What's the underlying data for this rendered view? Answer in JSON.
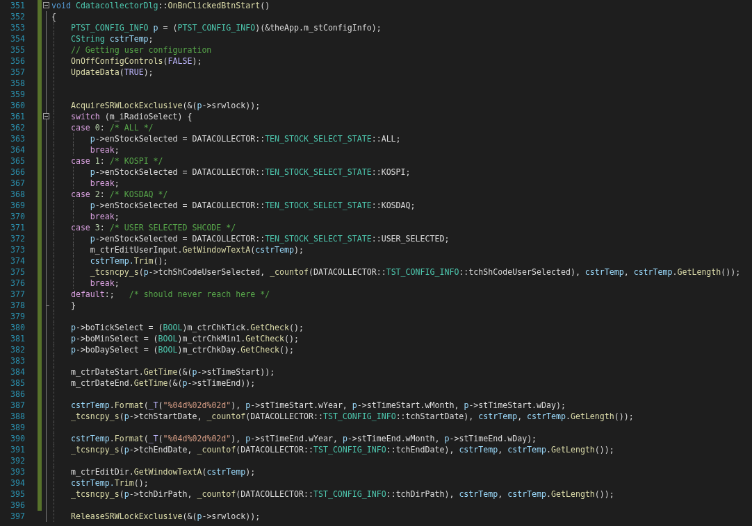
{
  "editor": {
    "lines": [
      {
        "n": "351",
        "collapsible": true,
        "block_end": false,
        "tokens": [
          {
            "text": "void",
            "kind": "keyword"
          },
          {
            "text": " CdatacollectorDlg",
            "kind": "type"
          },
          {
            "text": "::",
            "kind": "plain"
          },
          {
            "text": "OnBnClickedBtnStart",
            "kind": "function"
          },
          {
            "text": "()",
            "kind": "plain"
          }
        ]
      },
      {
        "n": "352",
        "collapsible": false,
        "block_end": false,
        "tokens": [
          {
            "text": "{",
            "kind": "plain"
          }
        ]
      },
      {
        "n": "353",
        "collapsible": false,
        "block_end": false,
        "tokens": [
          {
            "text": "    PTST_CONFIG_INFO",
            "kind": "type"
          },
          {
            "text": " p",
            "kind": "variable"
          },
          {
            "text": " = (",
            "kind": "plain"
          },
          {
            "text": "PTST_CONFIG_INFO",
            "kind": "type"
          },
          {
            "text": ")(&theApp.m_stConfigInfo);",
            "kind": "plain"
          }
        ]
      },
      {
        "n": "354",
        "collapsible": false,
        "block_end": false,
        "tokens": [
          {
            "text": "    CString",
            "kind": "type"
          },
          {
            "text": " cstrTemp",
            "kind": "variable"
          },
          {
            "text": ";",
            "kind": "plain"
          }
        ]
      },
      {
        "n": "355",
        "collapsible": false,
        "block_end": false,
        "tokens": [
          {
            "text": "    // Getting user configuration",
            "kind": "comment"
          }
        ]
      },
      {
        "n": "356",
        "collapsible": false,
        "block_end": false,
        "tokens": [
          {
            "text": "    OnOffConfigControls",
            "kind": "function"
          },
          {
            "text": "(",
            "kind": "plain"
          },
          {
            "text": "FALSE",
            "kind": "macro"
          },
          {
            "text": ");",
            "kind": "plain"
          }
        ]
      },
      {
        "n": "357",
        "collapsible": false,
        "block_end": false,
        "tokens": [
          {
            "text": "    UpdateData",
            "kind": "function"
          },
          {
            "text": "(",
            "kind": "plain"
          },
          {
            "text": "TRUE",
            "kind": "macro"
          },
          {
            "text": ");",
            "kind": "plain"
          }
        ]
      },
      {
        "n": "358",
        "collapsible": false,
        "block_end": false
      },
      {
        "n": "359",
        "collapsible": false,
        "block_end": false
      },
      {
        "n": "360",
        "collapsible": false,
        "block_end": false,
        "tokens": [
          {
            "text": "    AcquireSRWLockExclusive",
            "kind": "function"
          },
          {
            "text": "(&(",
            "kind": "plain"
          },
          {
            "text": "p",
            "kind": "variable"
          },
          {
            "text": "->srwlock));",
            "kind": "plain"
          }
        ]
      },
      {
        "n": "361",
        "collapsible": true,
        "block_end": false,
        "tokens": [
          {
            "text": "    switch",
            "kind": "control"
          },
          {
            "text": " (m_iRadioSelect) {",
            "kind": "plain"
          }
        ]
      },
      {
        "n": "362",
        "collapsible": false,
        "block_end": false,
        "tokens": [
          {
            "text": "    case",
            "kind": "control"
          },
          {
            "text": " 0",
            "kind": "number"
          },
          {
            "text": ": ",
            "kind": "plain"
          },
          {
            "text": "/* ALL */",
            "kind": "comment"
          }
        ]
      },
      {
        "n": "363",
        "collapsible": false,
        "block_end": false,
        "tokens": [
          {
            "text": "        p",
            "kind": "variable"
          },
          {
            "text": "->enStockSelected = DATACOLLECTOR::",
            "kind": "plain"
          },
          {
            "text": "TEN_STOCK_SELECT_STATE",
            "kind": "type"
          },
          {
            "text": "::ALL;",
            "kind": "plain"
          }
        ]
      },
      {
        "n": "364",
        "collapsible": false,
        "block_end": false,
        "tokens": [
          {
            "text": "        break",
            "kind": "control"
          },
          {
            "text": ";",
            "kind": "plain"
          }
        ]
      },
      {
        "n": "365",
        "collapsible": false,
        "block_end": false,
        "tokens": [
          {
            "text": "    case",
            "kind": "control"
          },
          {
            "text": " 1",
            "kind": "number"
          },
          {
            "text": ": ",
            "kind": "plain"
          },
          {
            "text": "/* KOSPI */",
            "kind": "comment"
          }
        ]
      },
      {
        "n": "366",
        "collapsible": false,
        "block_end": false,
        "tokens": [
          {
            "text": "        p",
            "kind": "variable"
          },
          {
            "text": "->enStockSelected = DATACOLLECTOR::",
            "kind": "plain"
          },
          {
            "text": "TEN_STOCK_SELECT_STATE",
            "kind": "type"
          },
          {
            "text": "::KOSPI;",
            "kind": "plain"
          }
        ]
      },
      {
        "n": "367",
        "collapsible": false,
        "block_end": false,
        "tokens": [
          {
            "text": "        break",
            "kind": "control"
          },
          {
            "text": ";",
            "kind": "plain"
          }
        ]
      },
      {
        "n": "368",
        "collapsible": false,
        "block_end": false,
        "tokens": [
          {
            "text": "    case",
            "kind": "control"
          },
          {
            "text": " 2",
            "kind": "number"
          },
          {
            "text": ": ",
            "kind": "plain"
          },
          {
            "text": "/* KOSDAQ */",
            "kind": "comment"
          }
        ]
      },
      {
        "n": "369",
        "collapsible": false,
        "block_end": false,
        "tokens": [
          {
            "text": "        p",
            "kind": "variable"
          },
          {
            "text": "->enStockSelected = DATACOLLECTOR::",
            "kind": "plain"
          },
          {
            "text": "TEN_STOCK_SELECT_STATE",
            "kind": "type"
          },
          {
            "text": "::KOSDAQ;",
            "kind": "plain"
          }
        ]
      },
      {
        "n": "370",
        "collapsible": false,
        "block_end": false,
        "tokens": [
          {
            "text": "        break",
            "kind": "control"
          },
          {
            "text": ";",
            "kind": "plain"
          }
        ]
      },
      {
        "n": "371",
        "collapsible": false,
        "block_end": false,
        "tokens": [
          {
            "text": "    case",
            "kind": "control"
          },
          {
            "text": " 3",
            "kind": "number"
          },
          {
            "text": ": ",
            "kind": "plain"
          },
          {
            "text": "/* USER SELECTED SHCODE */",
            "kind": "comment"
          }
        ]
      },
      {
        "n": "372",
        "collapsible": false,
        "block_end": false,
        "tokens": [
          {
            "text": "        p",
            "kind": "variable"
          },
          {
            "text": "->enStockSelected = DATACOLLECTOR::",
            "kind": "plain"
          },
          {
            "text": "TEN_STOCK_SELECT_STATE",
            "kind": "type"
          },
          {
            "text": "::USER_SELECTED;",
            "kind": "plain"
          }
        ]
      },
      {
        "n": "373",
        "collapsible": false,
        "block_end": false,
        "tokens": [
          {
            "text": "        m_ctrEditUserInput.",
            "kind": "plain"
          },
          {
            "text": "GetWindowTextA",
            "kind": "function"
          },
          {
            "text": "(",
            "kind": "plain"
          },
          {
            "text": "cstrTemp",
            "kind": "variable"
          },
          {
            "text": ");",
            "kind": "plain"
          }
        ]
      },
      {
        "n": "374",
        "collapsible": false,
        "block_end": false,
        "tokens": [
          {
            "text": "        cstrTemp.",
            "kind": "variable"
          },
          {
            "text": "Trim",
            "kind": "function"
          },
          {
            "text": "();",
            "kind": "plain"
          }
        ]
      },
      {
        "n": "375",
        "collapsible": false,
        "block_end": false,
        "tokens": [
          {
            "text": "        _tcsncpy_s",
            "kind": "function"
          },
          {
            "text": "(",
            "kind": "plain"
          },
          {
            "text": "p",
            "kind": "variable"
          },
          {
            "text": "->tchShCodeUserSelected, ",
            "kind": "plain"
          },
          {
            "text": "_countof",
            "kind": "function"
          },
          {
            "text": "(DATACOLLECTOR::",
            "kind": "plain"
          },
          {
            "text": "TST_CONFIG_INFO",
            "kind": "type"
          },
          {
            "text": "::tchShCodeUserSelected), ",
            "kind": "plain"
          },
          {
            "text": "cstrTemp",
            "kind": "variable"
          },
          {
            "text": ", ",
            "kind": "plain"
          },
          {
            "text": "cstrTemp",
            "kind": "variable"
          },
          {
            "text": ".",
            "kind": "plain"
          },
          {
            "text": "GetLength",
            "kind": "function"
          },
          {
            "text": "());",
            "kind": "plain"
          }
        ]
      },
      {
        "n": "376",
        "collapsible": false,
        "block_end": false,
        "tokens": [
          {
            "text": "        break",
            "kind": "control"
          },
          {
            "text": ";",
            "kind": "plain"
          }
        ]
      },
      {
        "n": "377",
        "collapsible": false,
        "block_end": false,
        "tokens": [
          {
            "text": "    default",
            "kind": "control"
          },
          {
            "text": ":;   ",
            "kind": "plain"
          },
          {
            "text": "/* should never reach here */",
            "kind": "comment"
          }
        ]
      },
      {
        "n": "378",
        "collapsible": false,
        "block_end": true,
        "tokens": [
          {
            "text": "    }",
            "kind": "plain"
          }
        ]
      },
      {
        "n": "379",
        "collapsible": false,
        "block_end": false
      },
      {
        "n": "380",
        "collapsible": false,
        "block_end": false,
        "tokens": [
          {
            "text": "    p",
            "kind": "variable"
          },
          {
            "text": "->boTickSelect = (",
            "kind": "plain"
          },
          {
            "text": "BOOL",
            "kind": "type"
          },
          {
            "text": ")m_ctrChkTick.",
            "kind": "plain"
          },
          {
            "text": "GetCheck",
            "kind": "function"
          },
          {
            "text": "();",
            "kind": "plain"
          }
        ]
      },
      {
        "n": "381",
        "collapsible": false,
        "block_end": false,
        "tokens": [
          {
            "text": "    p",
            "kind": "variable"
          },
          {
            "text": "->boMinSelect = (",
            "kind": "plain"
          },
          {
            "text": "BOOL",
            "kind": "type"
          },
          {
            "text": ")m_ctrChkMin1.",
            "kind": "plain"
          },
          {
            "text": "GetCheck",
            "kind": "function"
          },
          {
            "text": "();",
            "kind": "plain"
          }
        ]
      },
      {
        "n": "382",
        "collapsible": false,
        "block_end": false,
        "tokens": [
          {
            "text": "    p",
            "kind": "variable"
          },
          {
            "text": "->boDaySelect = (",
            "kind": "plain"
          },
          {
            "text": "BOOL",
            "kind": "type"
          },
          {
            "text": ")m_ctrChkDay.",
            "kind": "plain"
          },
          {
            "text": "GetCheck",
            "kind": "function"
          },
          {
            "text": "();",
            "kind": "plain"
          }
        ]
      },
      {
        "n": "383",
        "collapsible": false,
        "block_end": false
      },
      {
        "n": "384",
        "collapsible": false,
        "block_end": false,
        "tokens": [
          {
            "text": "    m_ctrDateStart.",
            "kind": "plain"
          },
          {
            "text": "GetTime",
            "kind": "function"
          },
          {
            "text": "(&(",
            "kind": "plain"
          },
          {
            "text": "p",
            "kind": "variable"
          },
          {
            "text": "->stTimeStart));",
            "kind": "plain"
          }
        ]
      },
      {
        "n": "385",
        "collapsible": false,
        "block_end": false,
        "tokens": [
          {
            "text": "    m_ctrDateEnd.",
            "kind": "plain"
          },
          {
            "text": "GetTime",
            "kind": "function"
          },
          {
            "text": "(&(",
            "kind": "plain"
          },
          {
            "text": "p",
            "kind": "variable"
          },
          {
            "text": "->stTimeEnd));",
            "kind": "plain"
          }
        ]
      },
      {
        "n": "386",
        "collapsible": false,
        "block_end": false
      },
      {
        "n": "387",
        "collapsible": false,
        "block_end": false,
        "tokens": [
          {
            "text": "    cstrTemp",
            "kind": "variable"
          },
          {
            "text": ".",
            "kind": "plain"
          },
          {
            "text": "Format",
            "kind": "function"
          },
          {
            "text": "(",
            "kind": "plain"
          },
          {
            "text": "_T",
            "kind": "macro"
          },
          {
            "text": "(",
            "kind": "plain"
          },
          {
            "text": "\"%04d%02d%02d\"",
            "kind": "string"
          },
          {
            "text": "), ",
            "kind": "plain"
          },
          {
            "text": "p",
            "kind": "variable"
          },
          {
            "text": "->stTimeStart.wYear, ",
            "kind": "plain"
          },
          {
            "text": "p",
            "kind": "variable"
          },
          {
            "text": "->stTimeStart.wMonth, ",
            "kind": "plain"
          },
          {
            "text": "p",
            "kind": "variable"
          },
          {
            "text": "->stTimeStart.wDay);",
            "kind": "plain"
          }
        ]
      },
      {
        "n": "388",
        "collapsible": false,
        "block_end": false,
        "tokens": [
          {
            "text": "    _tcsncpy_s",
            "kind": "function"
          },
          {
            "text": "(",
            "kind": "plain"
          },
          {
            "text": "p",
            "kind": "variable"
          },
          {
            "text": "->tchStartDate, ",
            "kind": "plain"
          },
          {
            "text": "_countof",
            "kind": "function"
          },
          {
            "text": "(DATACOLLECTOR::",
            "kind": "plain"
          },
          {
            "text": "TST_CONFIG_INFO",
            "kind": "type"
          },
          {
            "text": "::tchStartDate), ",
            "kind": "plain"
          },
          {
            "text": "cstrTemp",
            "kind": "variable"
          },
          {
            "text": ", ",
            "kind": "plain"
          },
          {
            "text": "cstrTemp",
            "kind": "variable"
          },
          {
            "text": ".",
            "kind": "plain"
          },
          {
            "text": "GetLength",
            "kind": "function"
          },
          {
            "text": "());",
            "kind": "plain"
          }
        ]
      },
      {
        "n": "389",
        "collapsible": false,
        "block_end": false
      },
      {
        "n": "390",
        "collapsible": false,
        "block_end": false,
        "tokens": [
          {
            "text": "    cstrTemp",
            "kind": "variable"
          },
          {
            "text": ".",
            "kind": "plain"
          },
          {
            "text": "Format",
            "kind": "function"
          },
          {
            "text": "(",
            "kind": "plain"
          },
          {
            "text": "_T",
            "kind": "macro"
          },
          {
            "text": "(",
            "kind": "plain"
          },
          {
            "text": "\"%04d%02d%02d\"",
            "kind": "string"
          },
          {
            "text": "), ",
            "kind": "plain"
          },
          {
            "text": "p",
            "kind": "variable"
          },
          {
            "text": "->stTimeEnd.wYear, ",
            "kind": "plain"
          },
          {
            "text": "p",
            "kind": "variable"
          },
          {
            "text": "->stTimeEnd.wMonth, ",
            "kind": "plain"
          },
          {
            "text": "p",
            "kind": "variable"
          },
          {
            "text": "->stTimeEnd.wDay);",
            "kind": "plain"
          }
        ]
      },
      {
        "n": "391",
        "collapsible": false,
        "block_end": false,
        "tokens": [
          {
            "text": "    _tcsncpy_s",
            "kind": "function"
          },
          {
            "text": "(",
            "kind": "plain"
          },
          {
            "text": "p",
            "kind": "variable"
          },
          {
            "text": "->tchEndDate, ",
            "kind": "plain"
          },
          {
            "text": "_countof",
            "kind": "function"
          },
          {
            "text": "(DATACOLLECTOR::",
            "kind": "plain"
          },
          {
            "text": "TST_CONFIG_INFO",
            "kind": "type"
          },
          {
            "text": "::tchEndDate), ",
            "kind": "plain"
          },
          {
            "text": "cstrTemp",
            "kind": "variable"
          },
          {
            "text": ", ",
            "kind": "plain"
          },
          {
            "text": "cstrTemp",
            "kind": "variable"
          },
          {
            "text": ".",
            "kind": "plain"
          },
          {
            "text": "GetLength",
            "kind": "function"
          },
          {
            "text": "());",
            "kind": "plain"
          }
        ]
      },
      {
        "n": "392",
        "collapsible": false,
        "block_end": false
      },
      {
        "n": "393",
        "collapsible": false,
        "block_end": false,
        "tokens": [
          {
            "text": "    m_ctrEditDir.",
            "kind": "plain"
          },
          {
            "text": "GetWindowTextA",
            "kind": "function"
          },
          {
            "text": "(",
            "kind": "plain"
          },
          {
            "text": "cstrTemp",
            "kind": "variable"
          },
          {
            "text": ");",
            "kind": "plain"
          }
        ]
      },
      {
        "n": "394",
        "collapsible": false,
        "block_end": false,
        "tokens": [
          {
            "text": "    cstrTemp.",
            "kind": "variable"
          },
          {
            "text": "Trim",
            "kind": "function"
          },
          {
            "text": "();",
            "kind": "plain"
          }
        ]
      },
      {
        "n": "395",
        "collapsible": false,
        "block_end": false,
        "tokens": [
          {
            "text": "    _tcsncpy_s",
            "kind": "function"
          },
          {
            "text": "(",
            "kind": "plain"
          },
          {
            "text": "p",
            "kind": "variable"
          },
          {
            "text": "->tchDirPath, ",
            "kind": "plain"
          },
          {
            "text": "_countof",
            "kind": "function"
          },
          {
            "text": "(DATACOLLECTOR::",
            "kind": "plain"
          },
          {
            "text": "TST_CONFIG_INFO",
            "kind": "type"
          },
          {
            "text": "::tchDirPath), ",
            "kind": "plain"
          },
          {
            "text": "cstrTemp",
            "kind": "variable"
          },
          {
            "text": ", ",
            "kind": "plain"
          },
          {
            "text": "cstrTemp",
            "kind": "variable"
          },
          {
            "text": ".",
            "kind": "plain"
          },
          {
            "text": "GetLength",
            "kind": "function"
          },
          {
            "text": "());",
            "kind": "plain"
          }
        ]
      },
      {
        "n": "396",
        "collapsible": false,
        "block_end": false
      },
      {
        "n": "397",
        "collapsible": false,
        "block_end": false,
        "tokens": [
          {
            "text": "    ReleaseSRWLockExclusive",
            "kind": "function"
          },
          {
            "text": "(&(",
            "kind": "plain"
          },
          {
            "text": "p",
            "kind": "variable"
          },
          {
            "text": "->srwlock));",
            "kind": "plain"
          }
        ]
      }
    ]
  }
}
